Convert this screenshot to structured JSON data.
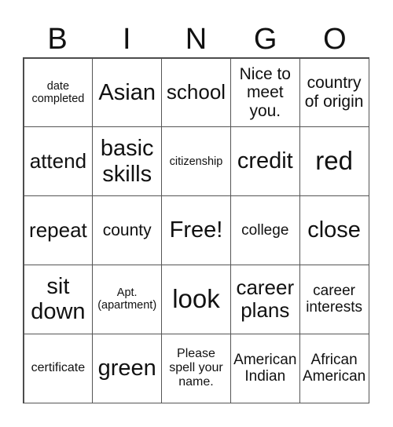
{
  "header": {
    "letters": [
      "B",
      "I",
      "N",
      "G",
      "O"
    ]
  },
  "cells": [
    [
      "date completed",
      "Asian",
      "school",
      "Nice to meet you.",
      "country of origin"
    ],
    [
      "attend",
      "basic skills",
      "citizenship",
      "credit",
      "red"
    ],
    [
      "repeat",
      "county",
      "Free!",
      "college",
      "close"
    ],
    [
      "sit down",
      "Apt. (apartment)",
      "look",
      "career plans",
      "career interests"
    ],
    [
      "certificate",
      "green",
      "Please spell your name.",
      "American Indian",
      "African American"
    ]
  ]
}
